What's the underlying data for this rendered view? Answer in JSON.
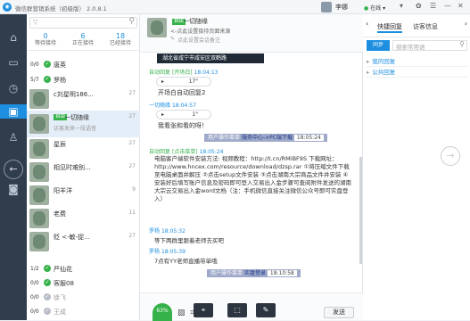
{
  "app": {
    "title": "微信群营销系统（初级版） 2.0.8.1"
  },
  "user": {
    "name": "李娜",
    "status": "在线"
  },
  "contacts": {
    "search_placeholder": "",
    "stats": [
      {
        "count": "0",
        "label": "等待接待"
      },
      {
        "count": "6",
        "label": "正在接待"
      },
      {
        "count": "18",
        "label": "已经接待"
      }
    ],
    "status_rows": [
      {
        "count": "0/0",
        "name": "唐英"
      },
      {
        "count": "5/7",
        "name": "罗杨"
      }
    ],
    "chats": [
      {
        "badge": "",
        "name": "c刘星明186...",
        "sub": "",
        "num": "27"
      },
      {
        "badge": "自由",
        "name": "一切随缘",
        "sub": "访客发来一段语音",
        "num": "27"
      },
      {
        "badge": "",
        "name": "星辰",
        "sub": "",
        "num": "27"
      },
      {
        "badge": "",
        "name": "相见时难别...",
        "sub": "",
        "num": "27"
      },
      {
        "badge": "",
        "name": "阳羊洋",
        "sub": "",
        "num": "9"
      },
      {
        "badge": "",
        "name": "老费",
        "sub": "",
        "num": "11"
      },
      {
        "badge": "",
        "name": "贬 <-敏-捉...",
        "sub": "",
        "num": "27"
      }
    ],
    "agents": [
      {
        "count": "1/2",
        "name": "严仙花",
        "online": true
      },
      {
        "count": "0/0",
        "name": "客服08",
        "online": true
      },
      {
        "count": "0/0",
        "name": "徐飞",
        "online": false
      },
      {
        "count": "0/0",
        "name": "王成",
        "online": false
      }
    ]
  },
  "chat": {
    "header": {
      "badge": "自由",
      "name": "一切随缘",
      "line1": "<-点此设置接待页面来源",
      "line2": "点此设置会话备注"
    },
    "location": "湖北省咸宁市咸安区双鹤路",
    "messages": [
      {
        "sender": "自动回复",
        "tag": "[开场白]",
        "time": "18:04:13",
        "duration": "17\"",
        "text": "开场白自动回复2"
      },
      {
        "sender": "一切随缘",
        "time": "18:04:57",
        "duration": "1\"",
        "text": "我看张和看的呀！"
      }
    ],
    "sys1": {
      "label": "用户操作菜单",
      "action": "服务中心->PC端下载",
      "time": "18:05:24"
    },
    "auto2": {
      "sender": "自动回复",
      "tag": "[点击菜单]",
      "time": "18:05:24",
      "text": "电脑客户端软件安装方法: 视频教程：http://t.cn/RMiBF9S 下载网址：http://www.hncex.com/resource/download/dzsp.rar ①将压缩文件下载至电脑桌面并解压 ②点击setup文件安装 ③点击湖南大宗商品文件并安装 ④安装好后填写账户信息及密码即可登入交易出入金步骤可查阅附件发送的湖南大宗云交易出入金word文档（注：手机微信直接关注微信公众号即可实盘登入）"
    },
    "luo1": {
      "sender": "罗杨",
      "time": "18:05:32",
      "text": "等下两群里跟着老师去买吧"
    },
    "luo2": {
      "sender": "罗杨",
      "time": "18:05:39",
      "text": "7点有YY老师直播带单哦"
    },
    "sys2": {
      "label": "用户操作菜单",
      "action": "实盘登录",
      "time": "18:10:58"
    }
  },
  "toolbar": {
    "progress": "63%",
    "send": "发送"
  },
  "right": {
    "tab_quick": "快捷回复",
    "tab_visitor": "访客信息",
    "sync": "同步",
    "search_placeholder": "搜索常用语",
    "items": [
      "我的回复",
      "公共回复"
    ]
  }
}
